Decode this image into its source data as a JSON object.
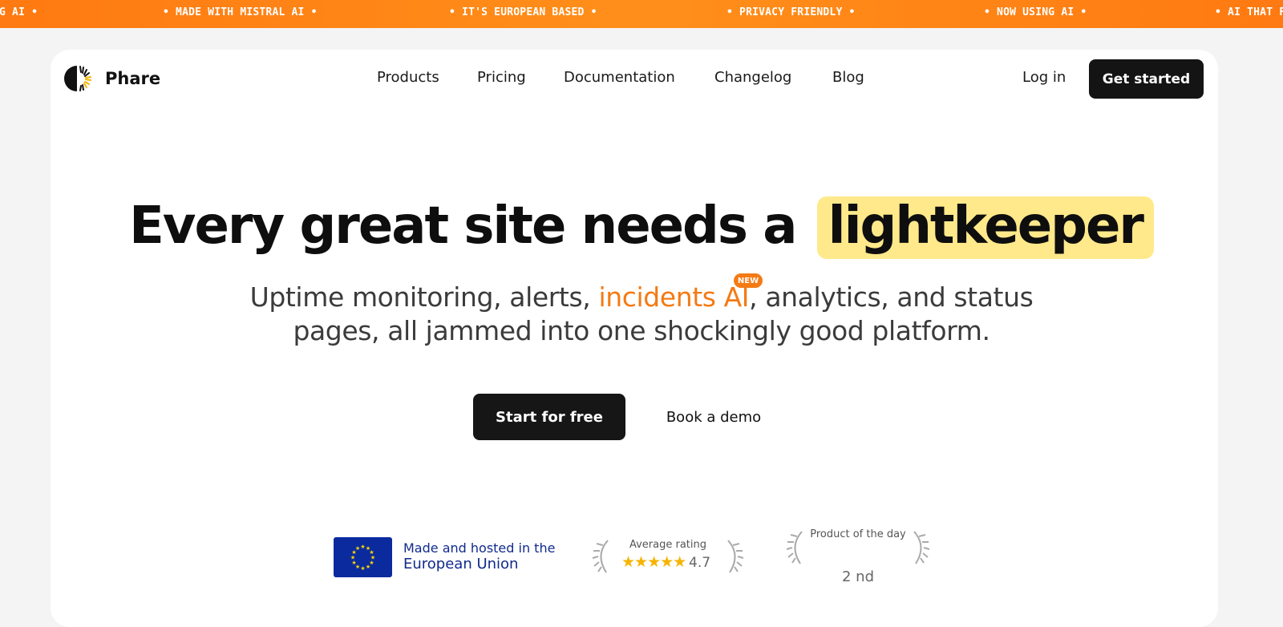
{
  "ticker": {
    "items": [
      "G AI •",
      "• MADE WITH MISTRAL AI •",
      "• IT'S EUROPEAN BASED •",
      "• PRIVACY FRIENDLY •",
      "• NOW USING AI •",
      "• AI THAT F"
    ]
  },
  "brand": {
    "name": "Phare"
  },
  "nav": {
    "items": [
      "Products",
      "Pricing",
      "Documentation",
      "Changelog",
      "Blog"
    ],
    "login": "Log in",
    "cta": "Get started"
  },
  "hero": {
    "title_prefix": "Every great site needs a",
    "title_highlight": "lightkeeper",
    "subtitle_part1": "Uptime monitoring, alerts, ",
    "subtitle_accent": "incidents AI",
    "subtitle_part2": ", analytics, and status",
    "subtitle_line2": "pages, all jammed into one shockingly good platform.",
    "badge": "NEW",
    "primary_button": "Start for free",
    "secondary_button": "Book a demo"
  },
  "trust": {
    "eu_line1": "Made and hosted in the",
    "eu_line2": "European Union",
    "rating_label": "Average rating",
    "rating_value": "4.7",
    "rating_stars": 4.7,
    "potd_label": "Product of the day",
    "potd_rank": "2 nd"
  },
  "colors": {
    "ticker_bg": "#ff7a12",
    "accent": "#f47a14",
    "highlight": "#ffe98a",
    "eu_blue": "#0b2a9e",
    "star": "#f6b400"
  }
}
